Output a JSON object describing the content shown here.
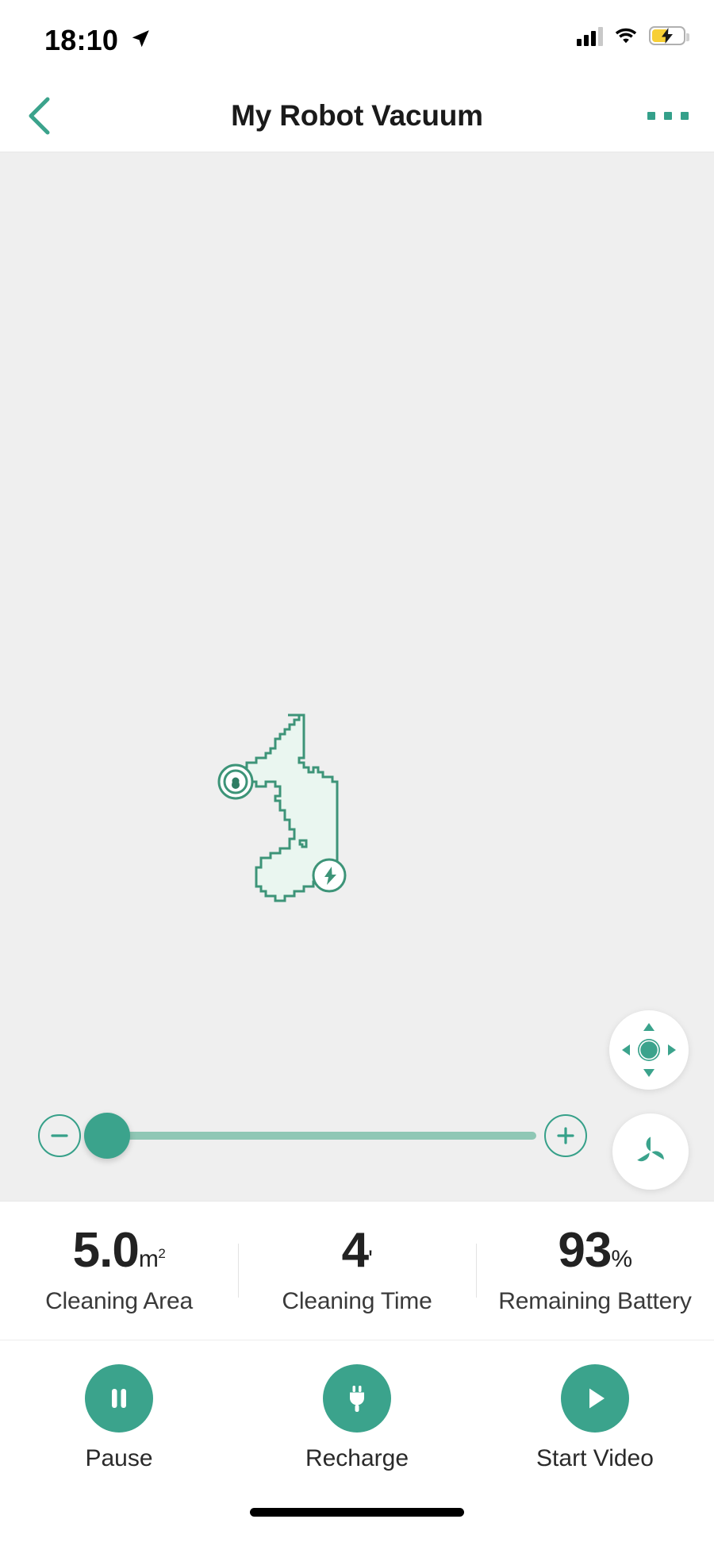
{
  "status_bar": {
    "time": "18:10",
    "location_icon": "location-arrow-icon",
    "signal_icon": "cellular-signal-icon",
    "wifi_icon": "wifi-icon",
    "battery_icon": "battery-charging-icon",
    "battery_charging": true
  },
  "nav": {
    "back_icon": "chevron-left-icon",
    "title": "My Robot Vacuum",
    "more_icon": "more-horizontal-icon"
  },
  "map": {
    "robot_marker_icon": "robot-position-icon",
    "dock_marker_icon": "charging-dock-icon",
    "fill_color": "#eaf6f0",
    "stroke_color": "#3d9478",
    "background_color": "#efefef"
  },
  "controls": {
    "dpad_icon": "direction-pad-icon",
    "dpad_up_icon": "chevron-up-icon",
    "dpad_down_icon": "chevron-down-icon",
    "dpad_left_icon": "chevron-left-icon",
    "dpad_right_icon": "chevron-right-icon",
    "dpad_center_icon": "circle-center-icon",
    "fan_icon": "fan-speed-icon",
    "minus_icon": "minus-circle-icon",
    "plus_icon": "plus-circle-icon",
    "slider_value": 4,
    "slider_min": 0,
    "slider_max": 100
  },
  "stats": [
    {
      "value": "5.0",
      "unit": "m",
      "unit_sup": "2",
      "label": "Cleaning Area"
    },
    {
      "value": "4",
      "unit": "'",
      "unit_sup": "",
      "label": "Cleaning Time"
    },
    {
      "value": "93",
      "unit": "%",
      "unit_sup": "",
      "label": "Remaining Battery"
    }
  ],
  "actions": [
    {
      "label": "Pause",
      "icon": "pause-icon"
    },
    {
      "label": "Recharge",
      "icon": "power-plug-icon"
    },
    {
      "label": "Start Video",
      "icon": "play-icon"
    }
  ],
  "colors": {
    "accent": "#3ba38c",
    "accent_dark": "#36a089",
    "map_stroke": "#3d9478",
    "map_fill": "#eaf6f0",
    "battery_yellow": "#f7cf35"
  },
  "home_indicator": "home-indicator-bar"
}
